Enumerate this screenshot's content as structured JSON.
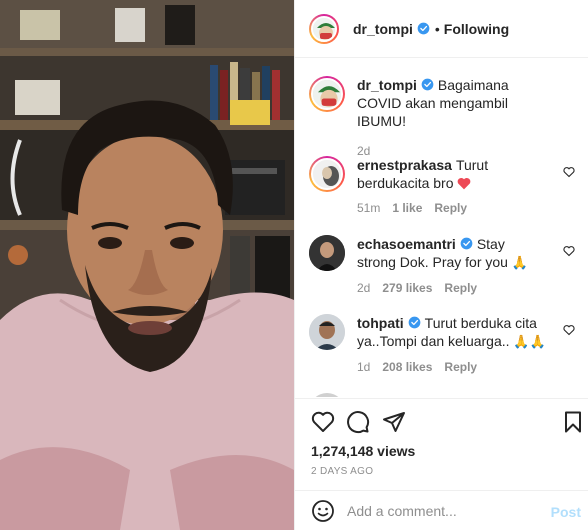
{
  "header": {
    "username": "dr_tompi",
    "separator": "•",
    "follow_status": "Following"
  },
  "caption": {
    "username": "dr_tompi",
    "text": "Bagaimana COVID akan mengambil IBUMU!",
    "time": "2d"
  },
  "comments": [
    {
      "username": "ernestprakasa",
      "text": "Turut berdukacita bro",
      "emoji": "heart",
      "time": "51m",
      "likes": "1 like",
      "reply": "Reply",
      "verified": false,
      "story_ring": true
    },
    {
      "username": "echasoemantri",
      "text": "Stay strong Dok. Pray for you",
      "emoji": "🙏",
      "time": "2d",
      "likes": "279 likes",
      "reply": "Reply",
      "verified": true,
      "story_ring": false
    },
    {
      "username": "tohpati",
      "text": "Turut berduka cita ya..Tompi dan keluarga..",
      "emoji": "🙏🙏",
      "time": "1d",
      "likes": "208 likes",
      "reply": "Reply",
      "verified": true,
      "story_ring": false
    }
  ],
  "actions": {
    "icons": [
      "heart-icon",
      "comment-icon",
      "share-icon",
      "bookmark-icon"
    ]
  },
  "views": "1,274,148 views",
  "posted_ago": "2 DAYS AGO",
  "add_comment": {
    "placeholder": "Add a comment...",
    "post_label": "Post"
  },
  "colors": {
    "verified": "#3897f0",
    "post_button_disabled": "#b2dffc",
    "muted_text": "#8e8e8e",
    "heart_emoji": "#ed4956"
  }
}
